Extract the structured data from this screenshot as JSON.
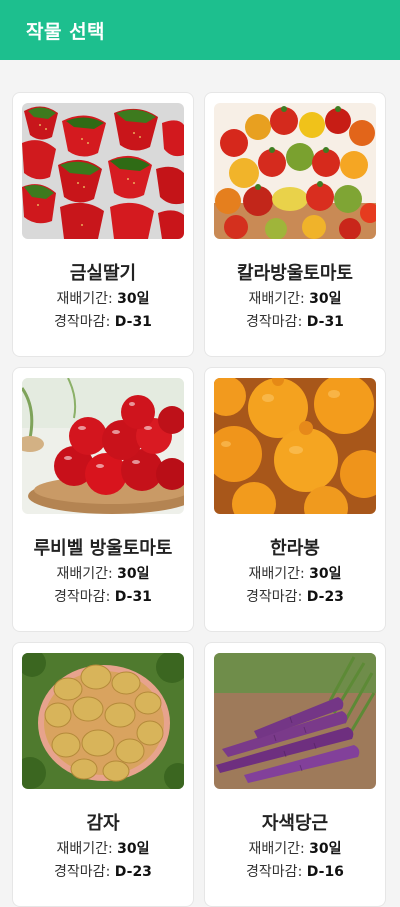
{
  "header": {
    "title": "작물 선택"
  },
  "crops": [
    {
      "name": "금실딸기",
      "period_label": "재배기간:",
      "period_value": "30일",
      "deadline_label": "경작마감:",
      "deadline_value": "D-31",
      "image": "strawberries"
    },
    {
      "name": "칼라방울토마토",
      "period_label": "재배기간:",
      "period_value": "30일",
      "deadline_label": "경작마감:",
      "deadline_value": "D-31",
      "image": "color-cherry-tomatoes"
    },
    {
      "name": "루비벨 방울토마토",
      "period_label": "재배기간:",
      "period_value": "30일",
      "deadline_label": "경작마감:",
      "deadline_value": "D-31",
      "image": "red-cherry-tomatoes"
    },
    {
      "name": "한라봉",
      "period_label": "재배기간:",
      "period_value": "30일",
      "deadline_label": "경작마감:",
      "deadline_value": "D-23",
      "image": "hallabong-oranges"
    },
    {
      "name": "감자",
      "period_label": "재배기간:",
      "period_value": "30일",
      "deadline_label": "경작마감:",
      "deadline_value": "D-23",
      "image": "potatoes"
    },
    {
      "name": "자색당근",
      "period_label": "재배기간:",
      "period_value": "30일",
      "deadline_label": "경작마감:",
      "deadline_value": "D-16",
      "image": "purple-carrots"
    }
  ]
}
